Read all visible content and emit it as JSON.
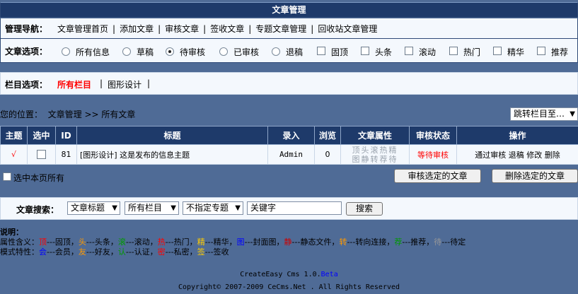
{
  "header": {
    "title": "文章管理"
  },
  "nav": {
    "label": "管理导航：",
    "links": [
      "文章管理首页",
      "添加文章",
      "审核文章",
      "签收文章",
      "专题文章管理",
      "回收站文章管理"
    ]
  },
  "options": {
    "label": "文章选项：",
    "radios": [
      {
        "label": "所有信息",
        "checked": false
      },
      {
        "label": "草稿",
        "checked": false
      },
      {
        "label": "待审核",
        "checked": true
      },
      {
        "label": "已审核",
        "checked": false
      },
      {
        "label": "退稿",
        "checked": false
      }
    ],
    "checks": [
      "固顶",
      "头条",
      "滚动",
      "热门",
      "精华",
      "推荐"
    ]
  },
  "category": {
    "label": "栏目选项：",
    "active": "所有栏目",
    "other": "图形设计",
    "sep": "|"
  },
  "location": {
    "text": "您的位置：  文章管理 >> 所有文章",
    "jump_select": "跳转栏目至…"
  },
  "table": {
    "headers": [
      "主题",
      "选中",
      "ID",
      "标题",
      "录入",
      "浏览",
      "文章属性",
      "审核状态",
      "操作"
    ],
    "rows": [
      {
        "mark": "√",
        "id": "81",
        "title": "[图形设计] 这是发布的信息主题",
        "author": "Admin",
        "views": "0",
        "attr_line1": "顶头滚热精",
        "attr_line2": "图静转荐待",
        "status": "等待审核",
        "ops": [
          "通过审核",
          "退稿",
          "修改",
          "删除"
        ]
      }
    ]
  },
  "bulk": {
    "select_all": "选中本页所有",
    "approve_btn": "审核选定的文章",
    "delete_btn": "删除选定的文章"
  },
  "search": {
    "label": "文章搜索：",
    "field_select": "文章标题",
    "column_select": "所有栏目",
    "topic_select": "不指定专题",
    "keyword_value": "关键字",
    "button": "搜索"
  },
  "notes": {
    "title": "说明：",
    "line1": [
      {
        "t": "属性含义：",
        "c": "#000"
      },
      {
        "t": "顶",
        "c": "#ff0000"
      },
      {
        "t": "---固顶，",
        "c": "#000"
      },
      {
        "t": "头",
        "c": "#ff9900"
      },
      {
        "t": "---头条，",
        "c": "#000"
      },
      {
        "t": "滚",
        "c": "#009900"
      },
      {
        "t": "---滚动，",
        "c": "#000"
      },
      {
        "t": "热",
        "c": "#ff0000"
      },
      {
        "t": "---热门，",
        "c": "#000"
      },
      {
        "t": "精",
        "c": "#ffcc00"
      },
      {
        "t": "---精华，",
        "c": "#000"
      },
      {
        "t": "图",
        "c": "#0000ff"
      },
      {
        "t": "---封面图，",
        "c": "#000"
      },
      {
        "t": "静",
        "c": "#cc0000"
      },
      {
        "t": "---静态文件，",
        "c": "#000"
      },
      {
        "t": "转",
        "c": "#ff9900"
      },
      {
        "t": "---转向连接，",
        "c": "#000"
      },
      {
        "t": "荐",
        "c": "#009900"
      },
      {
        "t": "---推荐，",
        "c": "#000"
      },
      {
        "t": "待",
        "c": "#999999"
      },
      {
        "t": "---待定",
        "c": "#000"
      }
    ],
    "line2": [
      {
        "t": "模式特性：",
        "c": "#000"
      },
      {
        "t": "会",
        "c": "#0000ff"
      },
      {
        "t": "---会员，",
        "c": "#000"
      },
      {
        "t": "友",
        "c": "#ff9900"
      },
      {
        "t": "---好友，",
        "c": "#000"
      },
      {
        "t": "认",
        "c": "#009900"
      },
      {
        "t": "---认证，",
        "c": "#000"
      },
      {
        "t": "密",
        "c": "#ff0000"
      },
      {
        "t": "---私密，",
        "c": "#000"
      },
      {
        "t": "签",
        "c": "#ffcc00"
      },
      {
        "t": "---签收",
        "c": "#000"
      }
    ]
  },
  "footer": {
    "product": "CreateEasy Cms 1.0.",
    "beta": "Beta",
    "copyright": "Copyright© 2007-2009 CeCms.Net . All Rights Reserved"
  },
  "colors": {
    "header_bg": "#1e3a6a",
    "page_bg": "#4f6b96",
    "panel_bg": "#f4f8fd",
    "alert_red": "#ff0000"
  }
}
